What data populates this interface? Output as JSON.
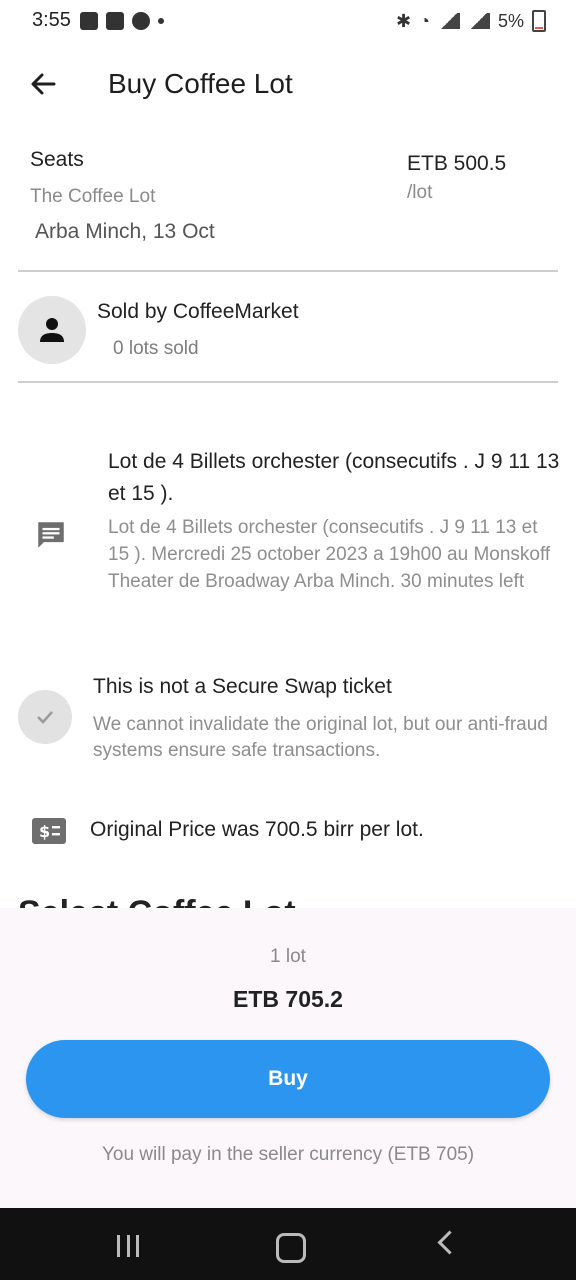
{
  "status_bar": {
    "time": "3:55",
    "battery": "5%"
  },
  "app_bar": {
    "title": "Buy Coffee Lot"
  },
  "listing": {
    "section": "Seats",
    "lot_name": "The Coffee Lot",
    "place_date": "Arba Minch, 13 Oct",
    "price": "ETB 500.5",
    "unit": "/lot"
  },
  "seller": {
    "name": "Sold by CoffeeMarket",
    "sold": "0 lots sold"
  },
  "description": {
    "title": "Lot de 4 Billets orchester (consecutifs . J 9 11 13 et 15 ).",
    "body": "Lot de 4 Billets orchester (consecutifs . J 9 11 13 et 15 ). Mercredi 25 october 2023 a 19h00 au Monskoff Theater de Broadway Arba Minch. 30 minutes left"
  },
  "secure_swap": {
    "title": "This is not a Secure Swap ticket",
    "subtitle": "We cannot invalidate the original lot, but our anti-fraud systems ensure safe transactions."
  },
  "original_price": "Original Price was 700.5 birr per lot.",
  "section_partial": "Select Coffee Lot",
  "checkout": {
    "quantity": "1 lot",
    "total": "ETB 705.2",
    "buy_label": "Buy",
    "note": "You will pay in the seller currency (ETB 705)"
  },
  "colors": {
    "accent": "#2b95ef",
    "sheet_bg": "#fbf7fb"
  }
}
